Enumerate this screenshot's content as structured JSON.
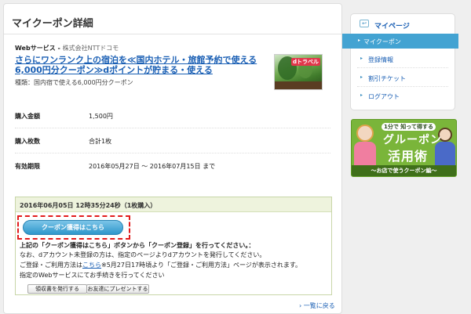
{
  "main": {
    "title": "マイクーポン詳細",
    "service_label": "Webサービス - ",
    "company": "株式会社NTTドコモ",
    "coupon_title": "さらにワンランク上の宿泊を≪国内ホテル・旅館予約で使える6,000円分クーポン≫dポイントが貯まる・使える",
    "coupon_kind": "種類：国内宿で使える6,000円分クーポン",
    "thumb_logo": "dトラベル",
    "rows": [
      {
        "label": "購入金額",
        "value": "1,500円"
      },
      {
        "label": "購入枚数",
        "value": "合計1枚"
      },
      {
        "label": "有効期限",
        "value": "2016年05月27日 〜 2016年07月15日 まで"
      }
    ]
  },
  "purchase": {
    "header": "2016年06月05日 12時35分24秒（1枚購入）",
    "get_button": "クーポン獲得はこちら",
    "note1": "上記の「クーポン獲得はこちら」ボタンから「クーポン登録」を行ってください。：",
    "note2": "なお、dアカウント未登録の方は、指定のページよりdアカウントを発行してください。",
    "note3_pre": "ご登録・ご利用方法は",
    "note3_link": "こちら",
    "note3_post": "※5月27日17時頃より「ご登録・ご利用方法」ページが表示されます。",
    "note4": "指定のWebサービスにてお手続きを行ってください",
    "receipt_button": "領収書を発行する",
    "gift_button": "お友達にプレゼントする"
  },
  "back_link": "一覧に戻る",
  "sidebar": {
    "header": "マイページ",
    "items": [
      {
        "label": "マイクーポン",
        "active": true
      },
      {
        "label": "登録情報",
        "active": false
      },
      {
        "label": "割引チケット",
        "active": false
      },
      {
        "label": "ログアウト",
        "active": false
      }
    ]
  },
  "banner": {
    "top": "1分で 知って得する",
    "line1": "グルーポン",
    "line2": "活用術",
    "bottom": "〜お店で使うクーポン編〜"
  },
  "colors": {
    "accent": "#43a3d2",
    "link": "#1a5fb4",
    "highlight": "#e21c1c",
    "banner": "#7ab53a"
  }
}
